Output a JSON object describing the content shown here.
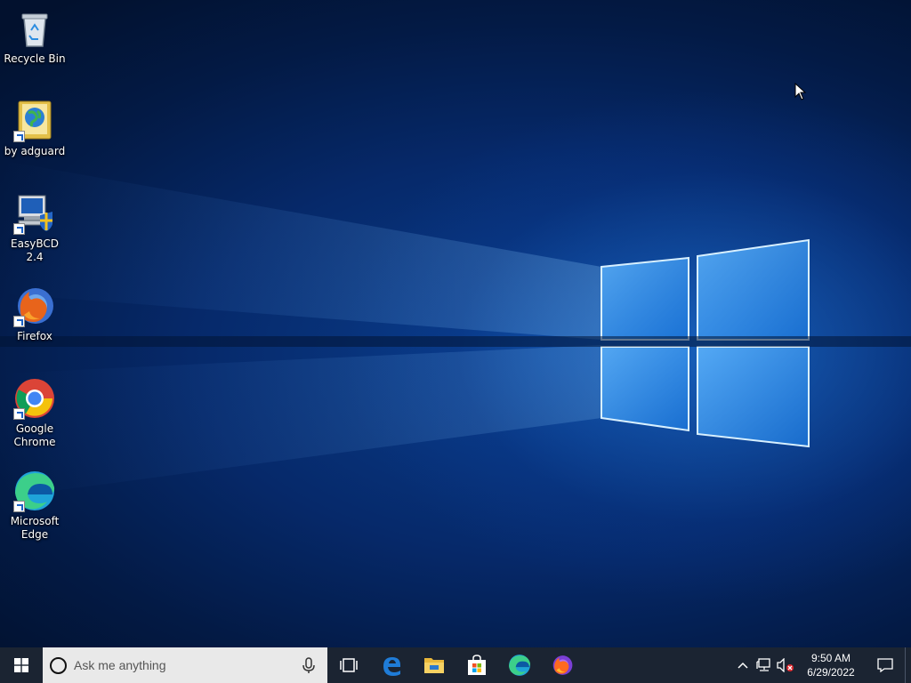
{
  "desktop": {
    "icons": [
      {
        "label": "Recycle Bin",
        "icon": "recycle-bin-icon"
      },
      {
        "label": "by adguard",
        "icon": "globe-book-icon"
      },
      {
        "label": "EasyBCD 2.4",
        "icon": "easybcd-icon"
      },
      {
        "label": "Firefox",
        "icon": "firefox-icon"
      },
      {
        "label": "Google Chrome",
        "icon": "chrome-icon"
      },
      {
        "label": "Microsoft Edge",
        "icon": "edge-icon"
      }
    ]
  },
  "taskbar": {
    "search": {
      "placeholder": "Ask me anything"
    },
    "pinned": [
      "task-view-icon",
      "edge-legacy-icon",
      "file-explorer-icon",
      "store-icon",
      "edge-icon",
      "firefox-icon"
    ],
    "tray": {
      "time": "9:50 AM",
      "date": "6/29/2022",
      "icons": [
        "chevron-up-icon",
        "network-icon",
        "volume-muted-icon",
        "action-center-icon"
      ]
    }
  },
  "colors": {
    "taskbar": "#1b2432",
    "accent": "#0078d7",
    "search_bg": "#e9e9e9"
  }
}
